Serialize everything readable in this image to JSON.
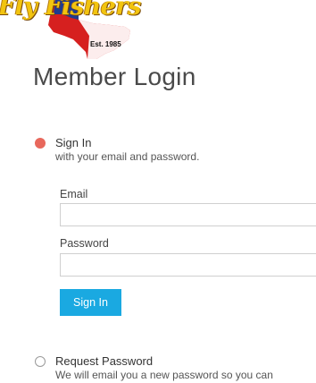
{
  "logo": {
    "wordmark": "Fly Fishers",
    "established": "Est. 1985"
  },
  "page_title": "Member Login",
  "options": {
    "sign_in": {
      "title": "Sign In",
      "description": "with your email and password.",
      "selected": true
    },
    "request_password": {
      "title": "Request Password",
      "description": "We will email you a new password so you can",
      "selected": false
    }
  },
  "form": {
    "email_label": "Email",
    "email_value": "",
    "password_label": "Password",
    "password_value": "",
    "submit_label": "Sign In"
  },
  "colors": {
    "accent": "#1aa9e1",
    "selected_radio": "#e8685c",
    "logo_gold": "#f2c40f",
    "logo_red": "#d6201f",
    "logo_blue": "#1f3c8f"
  }
}
